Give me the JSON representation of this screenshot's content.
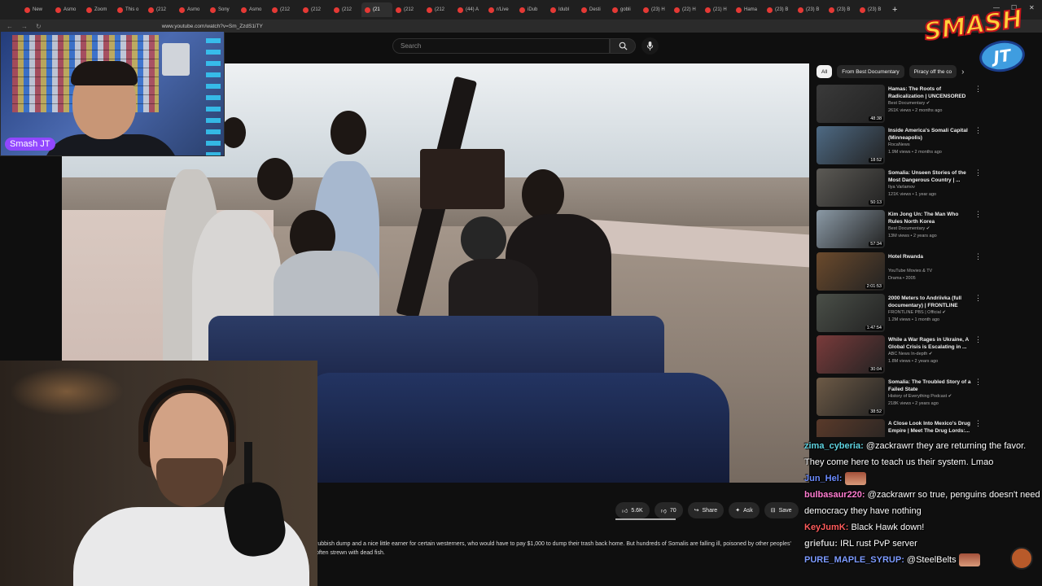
{
  "browser": {
    "tabs": [
      {
        "label": "New"
      },
      {
        "label": "Asmo"
      },
      {
        "label": "Zoom"
      },
      {
        "label": "This o"
      },
      {
        "label": "(212"
      },
      {
        "label": "Asmo"
      },
      {
        "label": "Sony"
      },
      {
        "label": "Asmo"
      },
      {
        "label": "(212"
      },
      {
        "label": "(212"
      },
      {
        "label": "(212"
      },
      {
        "label": "(21",
        "active": true
      },
      {
        "label": "(212"
      },
      {
        "label": "(212"
      },
      {
        "label": "(44) A"
      },
      {
        "label": "r/Live"
      },
      {
        "label": "iDub"
      },
      {
        "label": "Idubl"
      },
      {
        "label": "Desti"
      },
      {
        "label": "gobli"
      },
      {
        "label": "(23) H"
      },
      {
        "label": "(22) H"
      },
      {
        "label": "(21) H"
      },
      {
        "label": "Hama"
      },
      {
        "label": "(23) B"
      },
      {
        "label": "(23) B"
      },
      {
        "label": "(23) B"
      },
      {
        "label": "(23) B"
      }
    ],
    "new_tab": "+",
    "url": "www.youtube.com/watch?v=Sm_ZzdS1iTY"
  },
  "youtube": {
    "search_placeholder": "Search",
    "actions": {
      "likes": "5.6K",
      "dislikes": "70",
      "share": "Share",
      "ask": "Ask",
      "save": "Save",
      "more": "..."
    },
    "description": [
      "rubbish dump and a nice little earner for certain westerners, who would have to pay $1,000 to dump their trash back home. But hundreds of Somalis are falling ill, poisoned by other peoples'",
      "often strewn with dead fish."
    ],
    "chips": [
      {
        "label": "All",
        "active": true
      },
      {
        "label": "From Best Documentary",
        "active": false
      },
      {
        "label": "Piracy off the co",
        "active": false
      }
    ],
    "recommendations": [
      {
        "title": "Hamas: The Roots of Radicalization | UNCENSORED",
        "channel": "Best Documentary ✔",
        "meta": "261K views • 2 months ago",
        "duration": "48:38",
        "color": "#3a3a3a"
      },
      {
        "title": "Inside America's Somali Capital (Minneapolis)",
        "channel": "RocaNews",
        "meta": "1.9M views • 2 months ago",
        "duration": "18:52",
        "color": "#4e6a84"
      },
      {
        "title": "Somalia: Unseen Stories of the Most Dangerous Country | ...",
        "channel": "Ilya Varlamov",
        "meta": "121K views • 1 year ago",
        "duration": "50:13",
        "color": "#5c5a55"
      },
      {
        "title": "Kim Jong Un: The Man Who Rules North Korea",
        "channel": "Best Documentary ✔",
        "meta": "13M views • 2 years ago",
        "duration": "57:34",
        "color": "#8b9aa6"
      },
      {
        "title": "Hotel Rwanda",
        "channel": "YouTube Movies & TV",
        "meta": "Drama • 2005",
        "duration": "2:01:53",
        "color": "#6b4a2c"
      },
      {
        "title": "2000 Meters to Andriivka (full documentary) | FRONTLINE",
        "channel": "FRONTLINE PBS | Official ✔",
        "meta": "1.2M views • 1 month ago",
        "duration": "1:47:54",
        "color": "#4a4f48"
      },
      {
        "title": "While a War Rages in Ukraine, A Global Crisis is Escalating in ...",
        "channel": "ABC News In-depth ✔",
        "meta": "1.8M views • 2 years ago",
        "duration": "30:04",
        "color": "#7a3b3b"
      },
      {
        "title": "Somalia: The Troubled Story of a Failed State",
        "channel": "History of Everything Podcast ✔",
        "meta": "218K views • 2 years ago",
        "duration": "38:52",
        "color": "#6d5a46"
      },
      {
        "title": "A Close Look Into Mexico's Drug Empire | Meet The Drug Lords:...",
        "channel": "",
        "meta": "",
        "duration": "",
        "color": "#5a3a2a"
      }
    ]
  },
  "streamer": {
    "name_tag": "Smash JT",
    "logo_top": "SMASH",
    "logo_bottom": "JT"
  },
  "chat": [
    {
      "user": "zima_cyberia:",
      "color": "#5fd3e0",
      "text": " @zackrawrr they are returning the favor. They come here to teach us their system. Lmao",
      "emote": false
    },
    {
      "user": "Jun_Hel:",
      "color": "#6c8cff",
      "text": "",
      "emote": true
    },
    {
      "user": "bulbasaur220:",
      "color": "#ff7cd0",
      "text": " @zackrawrr so true, penguins doesn't need democracy they have nothing",
      "emote": false
    },
    {
      "user": "KeyJumK:",
      "color": "#ff5c5c",
      "text": " Black Hawk down!",
      "emote": false
    },
    {
      "user": "griefuu:",
      "color": "#c9c9c9",
      "text": " IRL rust PvP server",
      "emote": false
    },
    {
      "user": "PURE_MAPLE_SYRUP:",
      "color": "#7d9bff",
      "text": " @SteelBelts",
      "emote": true
    }
  ]
}
